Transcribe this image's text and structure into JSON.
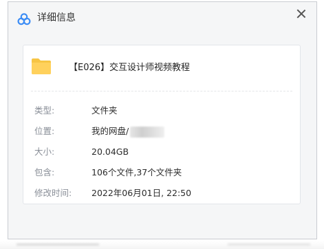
{
  "window": {
    "title": "详细信息",
    "app_icon": "baidu-netdisk-cloud-icon",
    "close_icon": "close-icon"
  },
  "file": {
    "name": "【E026】交互设计师视频教程",
    "icon": "folder-icon",
    "icon_color": "#F7C544"
  },
  "details": [
    {
      "label": "类型:",
      "value": "文件夹"
    },
    {
      "label": "位置:",
      "value": "我的网盘/"
    },
    {
      "label": "大小:",
      "value": "20.04GB"
    },
    {
      "label": "包含:",
      "value": "106个文件,37个文件夹"
    },
    {
      "label": "修改时间:",
      "value": "2022年06月01日, 22:50"
    }
  ],
  "colors": {
    "accent_blue": "#3B8CF5",
    "label_gray": "#8A8F98",
    "dialog_bg": "#F5F6F7"
  }
}
